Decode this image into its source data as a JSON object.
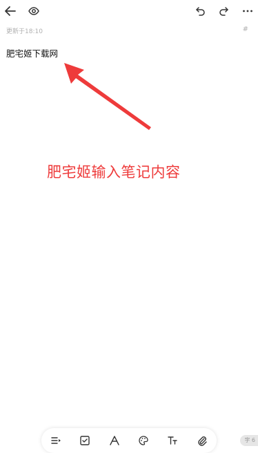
{
  "header": {
    "icons": [
      "back-arrow-icon",
      "eye-icon",
      "undo-icon",
      "redo-icon",
      "more-icon"
    ]
  },
  "meta": {
    "updated": "更新于18:10",
    "tag_symbol": "#"
  },
  "note": {
    "content": "肥宅姬下载网"
  },
  "annotation": {
    "text": "肥宅姬输入笔记内容",
    "color": "#ee3b3b"
  },
  "toolbar": {
    "tools": [
      "list-icon",
      "checkbox-icon",
      "font-icon",
      "palette-icon",
      "text-size-icon",
      "attachment-icon"
    ]
  },
  "footer": {
    "char_count": "字 6"
  }
}
